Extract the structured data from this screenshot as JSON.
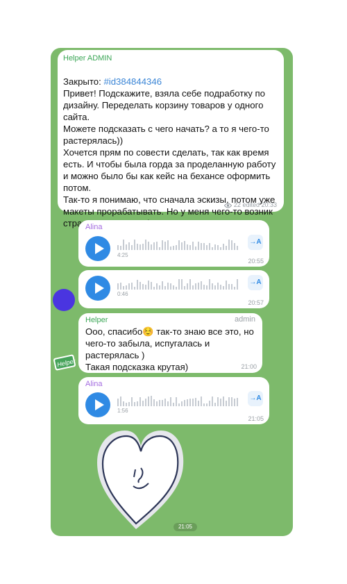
{
  "chat": {
    "message1": {
      "sender": "Helper ADMIN",
      "closed_prefix": "Закрыто: ",
      "closed_id": "#id384844346",
      "body": "Привет! Подскажите, взяла себе подработку по дизайну. Переделать корзину товаров у одного сайта.\nМожете подсказать с чего начать? а то я чего-то растерялась))\nХочется прям по совести сделать, так как  время есть. И чтобы была горда за проделанную работу и можно было бы как кейс на бехансе оформить потом.\nТак-то я понимаю, что сначала эскизы, потом уже макеты прорабатывать. Но у меня чего-то возник страх чистого листа)",
      "views": "22",
      "edited_time": "edited 20:33"
    },
    "voice1": {
      "sender": "Alina",
      "duration": "4:25",
      "time": "20:55",
      "transcribe_label": "→A"
    },
    "voice2": {
      "duration": "0:46",
      "time": "20:57",
      "transcribe_label": "→A"
    },
    "message2": {
      "sender": "Helper",
      "role": "admin",
      "body": "Ооо, спасибо☺️ так-то знаю все это, но чего-то забыла, испугалась и растерялась )\nТакая подсказка крутая)",
      "time": "21:00"
    },
    "voice3": {
      "sender": "Alina",
      "duration": "1:56",
      "time": "21:05",
      "transcribe_label": "→A"
    },
    "sticker": {
      "time": "21:05",
      "icon": "heart-face-sticker"
    },
    "helper_logo_text": "Helper",
    "colors": {
      "chat_bg": "#7dba6b",
      "accent_blue": "#2f8ae4",
      "admin_green": "#3aa655",
      "alina_purple": "#a36be0",
      "avatar": "#4a35e0"
    }
  }
}
